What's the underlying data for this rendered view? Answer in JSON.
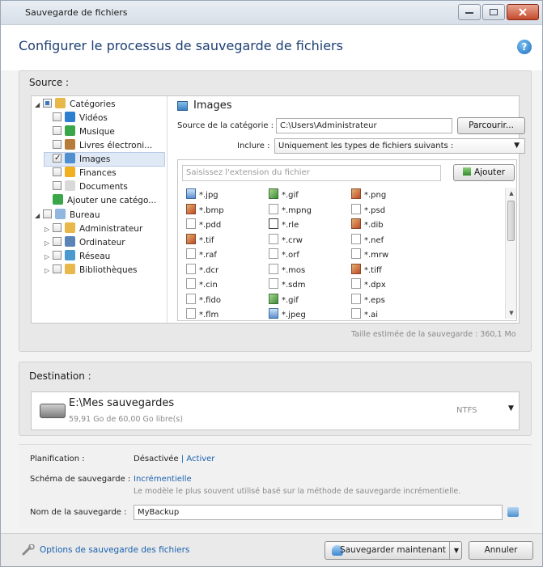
{
  "window": {
    "title": "Sauvegarde de fichiers"
  },
  "header": {
    "heading": "Configurer le processus de sauvegarde de fichiers"
  },
  "source": {
    "label": "Source :",
    "tree": [
      {
        "label": "Catégories",
        "level": 0,
        "expanded": true,
        "check": "partial",
        "icon": "categories-icon",
        "color": "#e8b84a"
      },
      {
        "label": "Vidéos",
        "level": 1,
        "check": "none",
        "icon": "video-icon",
        "color": "#2d7fd1"
      },
      {
        "label": "Musique",
        "level": 1,
        "check": "none",
        "icon": "music-icon",
        "color": "#3aa64a"
      },
      {
        "label": "Livres électroni...",
        "level": 1,
        "check": "none",
        "icon": "ebook-icon",
        "color": "#b77b3a"
      },
      {
        "label": "Images",
        "level": 1,
        "check": "checked",
        "icon": "images-icon",
        "color": "#4f8fd0",
        "selected": true
      },
      {
        "label": "Finances",
        "level": 1,
        "check": "none",
        "icon": "finances-icon",
        "color": "#f0b020"
      },
      {
        "label": "Documents",
        "level": 1,
        "check": "none",
        "icon": "documents-icon",
        "color": "#d9d9d9"
      },
      {
        "label": "Ajouter une catégo...",
        "level": 1,
        "check": "add",
        "icon": "add-category-icon",
        "color": "#3aa64a"
      },
      {
        "label": "Bureau",
        "level": 0,
        "expanded": true,
        "check": "none-noicon",
        "icon": "desktop-icon",
        "color": "#8fb7e0"
      },
      {
        "label": "Administrateur",
        "level": 1,
        "check": "none",
        "icon": "user-folder-icon",
        "color": "#e8b84a",
        "collapsed": true
      },
      {
        "label": "Ordinateur",
        "level": 1,
        "check": "none-noicon",
        "icon": "computer-icon",
        "color": "#5a84b8",
        "collapsed": true
      },
      {
        "label": "Réseau",
        "level": 1,
        "check": "none-noicon",
        "icon": "network-icon",
        "color": "#4a9ad0",
        "collapsed": true
      },
      {
        "label": "Bibliothèques",
        "level": 1,
        "check": "none",
        "icon": "libraries-icon",
        "color": "#e8b84a",
        "collapsed": true
      }
    ],
    "category_title": "Images",
    "category_source_label": "Source de la catégorie :",
    "category_source_value": "C:\\Users\\Administrateur",
    "browse_label": "Parcourir...",
    "include_label": "Inclure :",
    "include_value": "Uniquement les types de fichiers suivants :",
    "ext_placeholder": "Saisissez l'extension du fichier",
    "add_label": "Ajouter",
    "extensions": [
      [
        "*.jpg",
        "*.gif",
        "*.png"
      ],
      [
        "*.bmp",
        "*.mpng",
        "*.psd"
      ],
      [
        "*.pdd",
        "*.rle",
        "*.dib"
      ],
      [
        "*.tif",
        "*.crw",
        "*.nef"
      ],
      [
        "*.raf",
        "*.orf",
        "*.mrw"
      ],
      [
        "*.dcr",
        "*.mos",
        "*.tiff"
      ],
      [
        "*.cin",
        "*.sdm",
        "*.dpx"
      ],
      [
        "*.fido",
        "*.gif",
        "*.eps"
      ],
      [
        "*.flm",
        "*.jpeg",
        "*.ai"
      ]
    ],
    "ext_icons": [
      [
        "bmp",
        "gif",
        "img"
      ],
      [
        "img",
        "mono",
        "mono"
      ],
      [
        "mono",
        "rle",
        "img"
      ],
      [
        "img",
        "mono",
        "mono"
      ],
      [
        "mono",
        "mono",
        "mono"
      ],
      [
        "mono",
        "mono",
        "img"
      ],
      [
        "mono",
        "mono",
        "mono"
      ],
      [
        "mono",
        "gif",
        "mono"
      ],
      [
        "mono",
        "bmp",
        "mono"
      ]
    ],
    "estimated_size": "Taille estimée de la sauvegarde : 360,1 Mo"
  },
  "destination": {
    "label": "Destination :",
    "path": "E:\\Mes sauvegardes",
    "free": "59,91 Go de 60,00 Go libre(s)",
    "filesystem": "NTFS"
  },
  "options": {
    "schedule_label": "Planification :",
    "schedule_value": "Désactivée",
    "schedule_sep": "|",
    "schedule_link": "Activer",
    "scheme_label": "Schéma de sauvegarde :",
    "scheme_value": "Incrémentielle",
    "scheme_desc": "Le modèle le plus souvent utilisé basé sur la méthode de sauvegarde incrémentielle.",
    "name_label": "Nom de la sauvegarde :",
    "name_value": "MyBackup"
  },
  "footer": {
    "options_link": "Options de sauvegarde des fichiers",
    "save_now": "Sauvegarder maintenant",
    "cancel": "Annuler"
  },
  "colors": {
    "heading": "#1e3f73",
    "link": "#1a62b0",
    "muted": "#8a8a8a"
  }
}
